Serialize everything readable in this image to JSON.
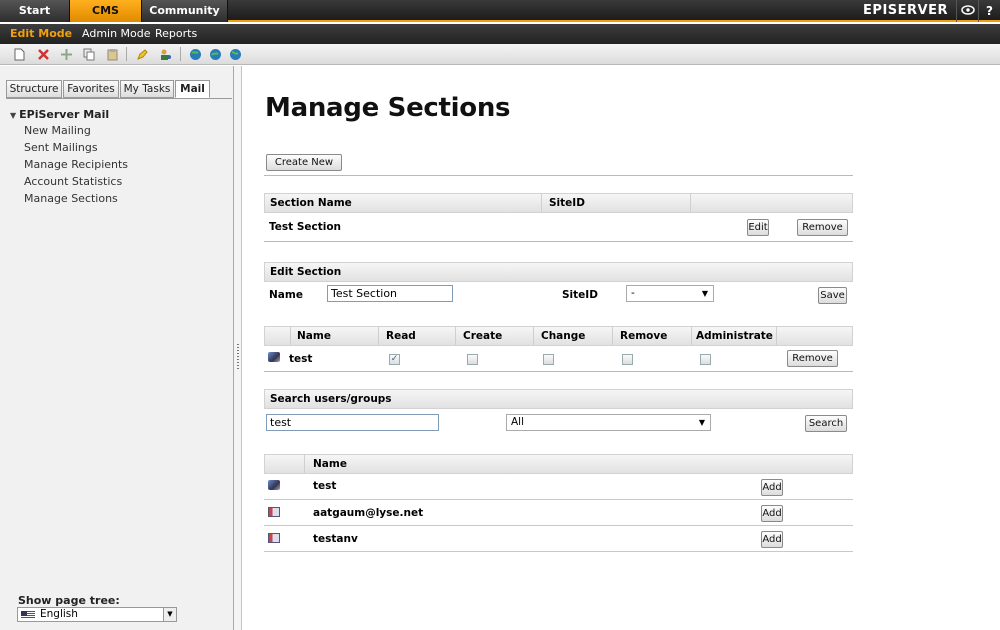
{
  "topbar": {
    "tabs": [
      "Start",
      "CMS",
      "Community"
    ],
    "brand": "EPISERVER",
    "help": "?"
  },
  "modebar": {
    "items": [
      "Edit Mode",
      "Admin Mode",
      "Reports"
    ]
  },
  "toolbar": {
    "icons": [
      "new-page-icon",
      "delete-icon",
      "move-icon",
      "copy-icon",
      "paste-icon",
      "edit-icon",
      "permissions-icon",
      "globe-icon",
      "globe-refresh-icon",
      "globe-link-icon"
    ]
  },
  "leftpane": {
    "tabs": [
      "Structure",
      "Favorites",
      "My Tasks",
      "Mail"
    ],
    "tree_root": "EPiServer Mail",
    "tree_items": [
      "New Mailing",
      "Sent Mailings",
      "Manage Recipients",
      "Account Statistics",
      "Manage Sections"
    ],
    "show_page_tree_label": "Show page tree:",
    "language": "English"
  },
  "main": {
    "title": "Manage Sections",
    "create_new": "Create New",
    "sections_table": {
      "headers": [
        "Section Name",
        "SiteID"
      ],
      "rows": [
        {
          "name": "Test Section",
          "siteid": ""
        }
      ],
      "edit_label": "Edit",
      "remove_label": "Remove"
    },
    "edit_section": {
      "header": "Edit Section",
      "name_label": "Name",
      "name_value": "Test Section",
      "siteid_label": "SiteID",
      "siteid_value": "-",
      "save_label": "Save"
    },
    "permissions_table": {
      "headers": [
        "Name",
        "Read",
        "Create",
        "Change",
        "Remove",
        "Administrate"
      ],
      "rows": [
        {
          "name": "test",
          "read": true,
          "create": false,
          "change": false,
          "remove": false,
          "administrate": false
        }
      ],
      "remove_label": "Remove"
    },
    "search": {
      "header": "Search users/groups",
      "query": "test",
      "filter": "All",
      "search_label": "Search"
    },
    "results_table": {
      "headers": [
        "Name"
      ],
      "rows": [
        {
          "name": "test",
          "type": "group"
        },
        {
          "name": "aatgaum@lyse.net",
          "type": "user"
        },
        {
          "name": "testanv",
          "type": "user"
        }
      ],
      "add_label": "Add"
    }
  }
}
